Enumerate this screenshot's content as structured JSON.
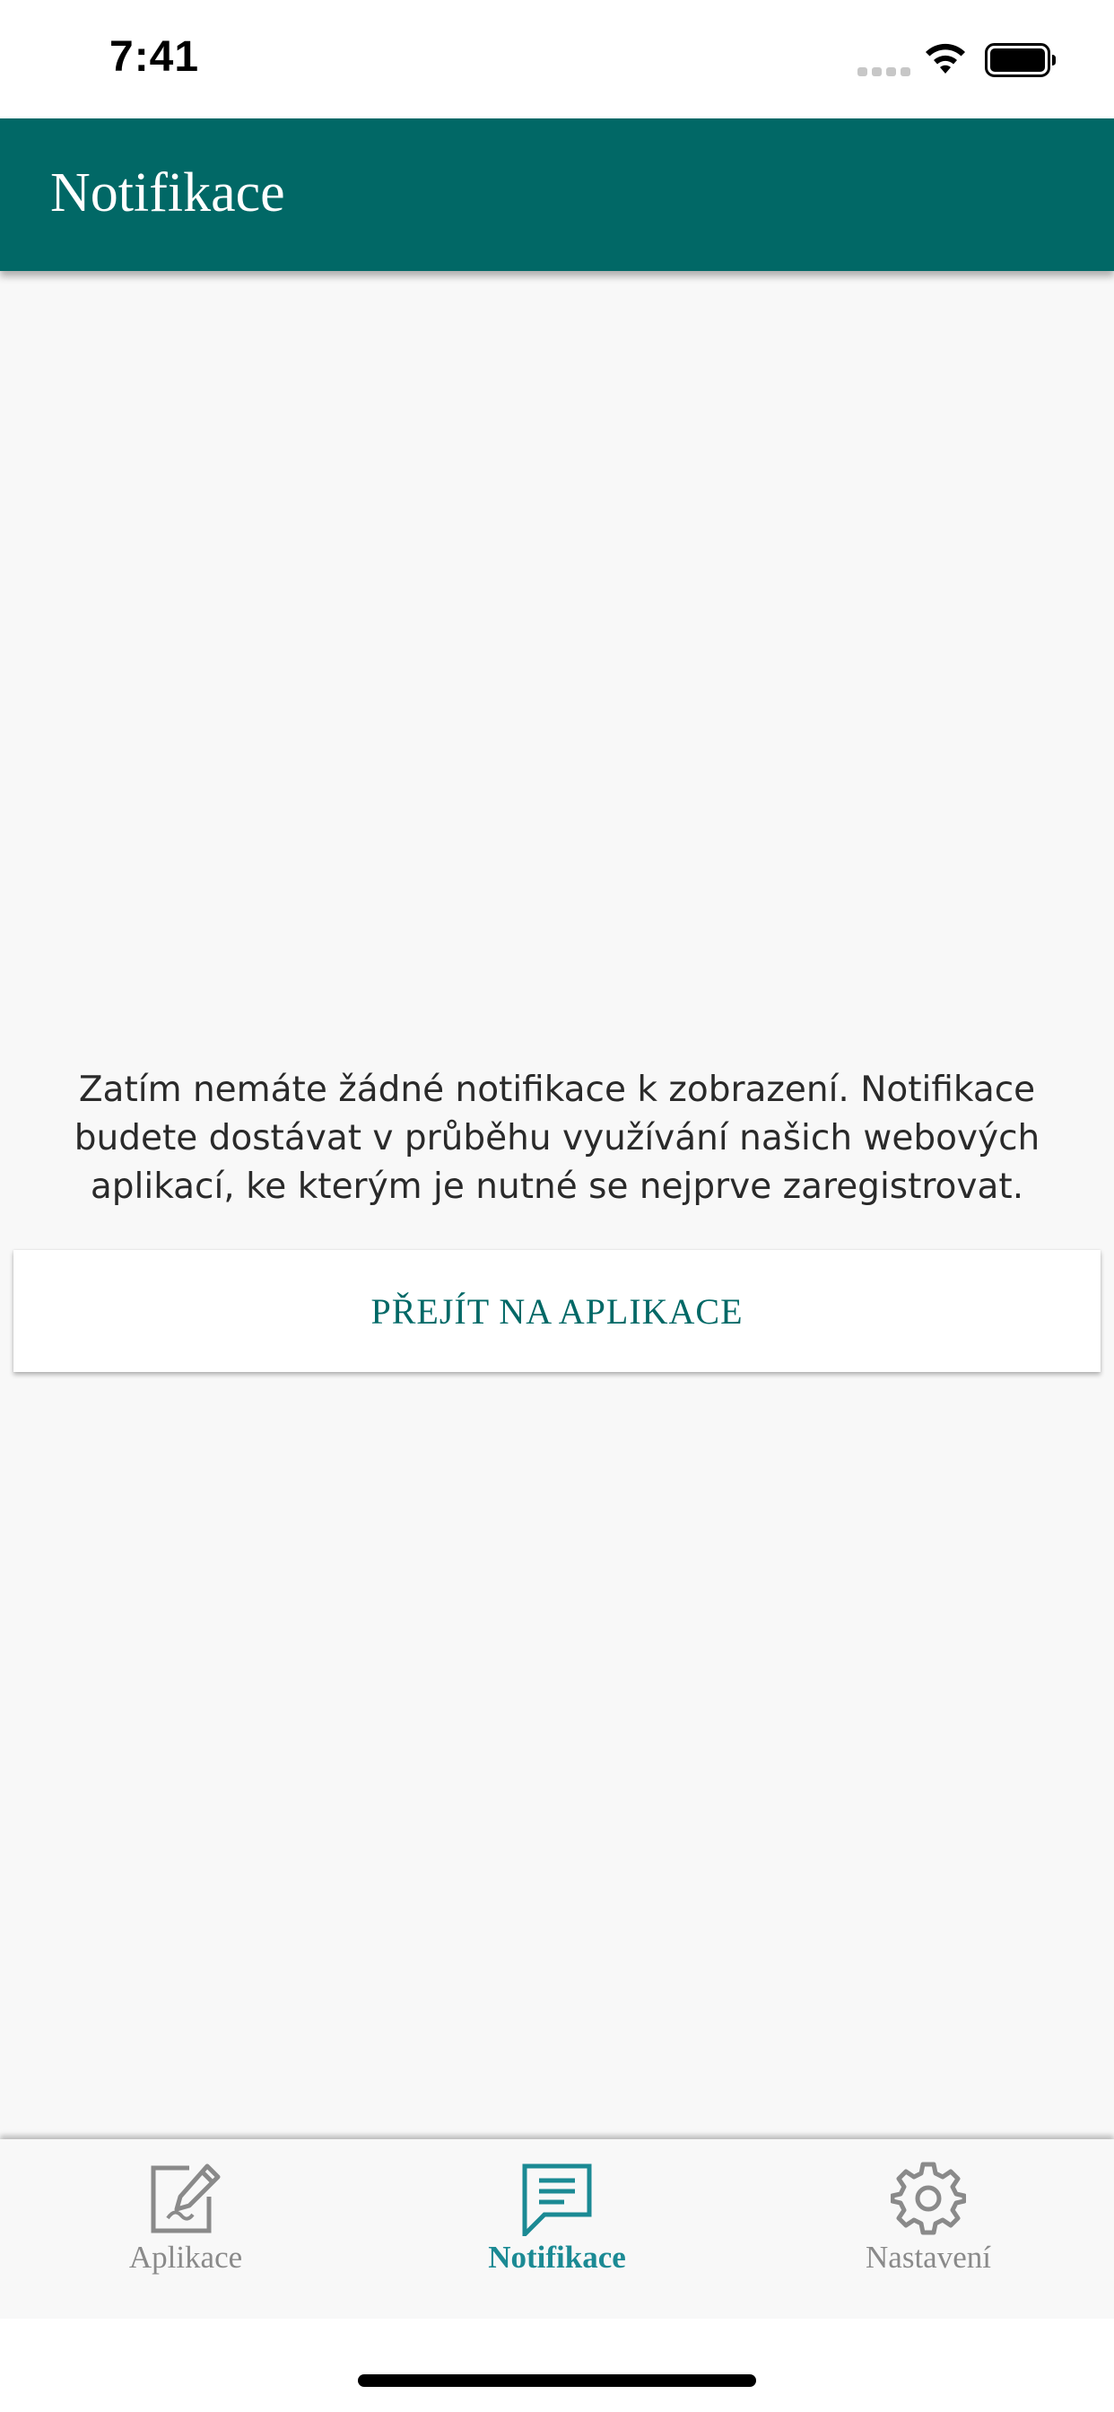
{
  "status_bar": {
    "time": "7:41",
    "signal_icon": "cellular-signal-icon",
    "wifi_icon": "wifi-icon",
    "battery_icon": "battery-icon"
  },
  "header": {
    "title": "Notifikace",
    "background_color": "#016866"
  },
  "empty_state": {
    "message": "Zatím nemáte žádné notifikace k zobrazení. Notifikace budete dostávat v průběhu využívání našich webových aplikací, ke kterým je nutné se nejprve zaregistrovat.",
    "button_label": "PŘEJÍT NA APLIKACE",
    "button_text_color": "#016866"
  },
  "tab_bar": {
    "active_color": "#1b8a94",
    "inactive_color": "#8a8a8a",
    "tabs": [
      {
        "label": "Aplikace",
        "icon": "edit-document-icon",
        "active": false
      },
      {
        "label": "Notifikace",
        "icon": "chat-bubble-icon",
        "active": true
      },
      {
        "label": "Nastavení",
        "icon": "gear-icon",
        "active": false
      }
    ]
  }
}
